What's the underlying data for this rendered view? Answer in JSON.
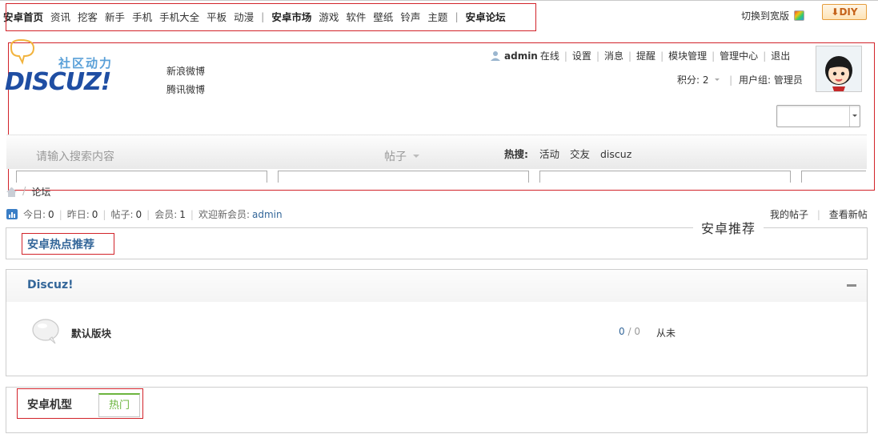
{
  "top_nav": {
    "items": [
      {
        "label": "安卓首页",
        "bold": true
      },
      {
        "label": "资讯"
      },
      {
        "label": "挖客"
      },
      {
        "label": "新手"
      },
      {
        "label": "手机"
      },
      {
        "label": "手机大全"
      },
      {
        "label": "平板"
      },
      {
        "label": "动漫"
      },
      {
        "sep": "|"
      },
      {
        "label": "安卓市场",
        "bold": true
      },
      {
        "label": "游戏"
      },
      {
        "label": "软件"
      },
      {
        "label": "壁纸"
      },
      {
        "label": "铃声"
      },
      {
        "label": "主题"
      },
      {
        "sep": "|"
      },
      {
        "label": "安卓论坛",
        "bold": true
      }
    ],
    "switch_wide": "切换到宽版",
    "diy": "DIY"
  },
  "header": {
    "logo_tagline": "社区动力",
    "logo_text": "DISCUZ!",
    "weibo": [
      "新浪微博",
      "腾讯微博"
    ],
    "user": {
      "name": "admin",
      "status": "在线",
      "links": [
        "设置",
        "消息",
        "提醒",
        "模块管理",
        "管理中心",
        "退出"
      ],
      "credits_label": "积分: 2",
      "usergroup_label": "用户组: 管理员"
    }
  },
  "search": {
    "placeholder": "请输入搜索内容",
    "type": "帖子",
    "hot_label": "热搜:",
    "hot_keywords": [
      "活动",
      "交友",
      "discuz"
    ]
  },
  "breadcrumb": {
    "current": "论坛"
  },
  "stats": {
    "today_label": "今日:",
    "today": "0",
    "yesterday_label": "昨日:",
    "yesterday": "0",
    "posts_label": "帖子:",
    "posts": "0",
    "members_label": "会员:",
    "members": "1",
    "welcome_label": "欢迎新会员:",
    "new_member": "admin"
  },
  "right_links": [
    "我的帖子",
    "查看新帖"
  ],
  "recommend": {
    "label": "安卓推荐",
    "title": "安卓热点推荐"
  },
  "category": {
    "title": "Discuz!",
    "forum": {
      "name": "默认版块",
      "threads": "0",
      "posts": "0",
      "last_post": "从未"
    }
  },
  "models": {
    "title": "安卓机型",
    "tab": "热门"
  }
}
